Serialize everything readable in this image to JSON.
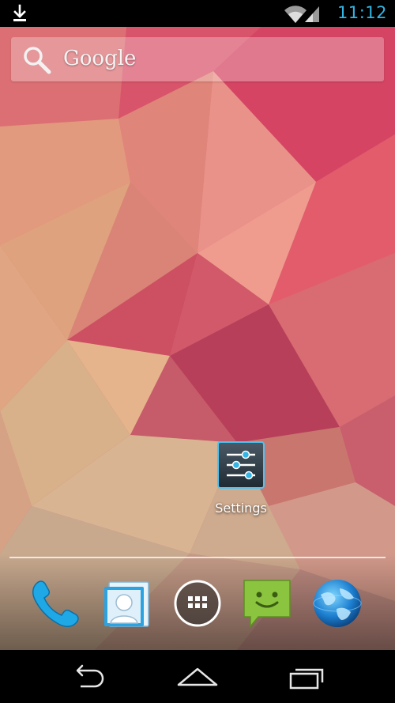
{
  "status_bar": {
    "time": "11:12",
    "icons": [
      "download-icon",
      "wifi-icon",
      "signal-icon"
    ]
  },
  "search": {
    "label": "Google",
    "icon": "search-icon"
  },
  "home": {
    "shortcuts": [
      {
        "label": "Settings",
        "icon": "settings-icon"
      }
    ]
  },
  "dock": {
    "items": [
      {
        "icon": "phone-icon"
      },
      {
        "icon": "people-icon"
      },
      {
        "icon": "all-apps-icon"
      },
      {
        "icon": "messaging-icon"
      },
      {
        "icon": "browser-icon"
      }
    ]
  },
  "nav_bar": {
    "buttons": [
      "back-icon",
      "home-icon",
      "recent-apps-icon"
    ]
  },
  "colors": {
    "accent": "#33b5e5",
    "status_bar_bg": "#000000"
  }
}
